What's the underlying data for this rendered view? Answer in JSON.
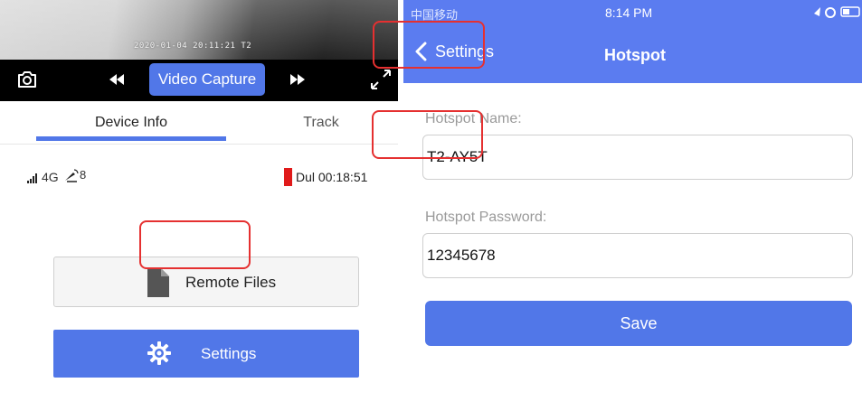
{
  "left_panel": {
    "video": {
      "timestamp": "2020-01-04 20:11:21 T2",
      "capture_label": "Video Capture",
      "camera_icon": "camera-icon",
      "rewind_icon": "rewind-icon",
      "forward_icon": "fast-forward-icon",
      "fullscreen_icon": "fullscreen-icon"
    },
    "tabs": [
      {
        "label": "Device Info",
        "active": true
      },
      {
        "label": "Track",
        "active": false
      }
    ],
    "status": {
      "network": "4G",
      "gps_satellites": "8",
      "recording": "Dul 00:18:51",
      "recording_color": "#e01a1a"
    },
    "buttons": {
      "remote_files": "Remote Files",
      "settings": "Settings"
    },
    "colors": {
      "accent": "#5177e8"
    }
  },
  "right_panel": {
    "status_bar": {
      "carrier": "中国移动",
      "time": "8:14 PM"
    },
    "nav": {
      "back_label": "Settings",
      "title": "Hotspot"
    },
    "form": {
      "name_label": "Hotspot Name:",
      "name_value": "T2-AY5T",
      "password_label": "Hotspot Password:",
      "password_value": "12345678",
      "save_label": "Save"
    },
    "colors": {
      "nav_bg": "#5b7cf0",
      "button": "#5177e8"
    }
  }
}
